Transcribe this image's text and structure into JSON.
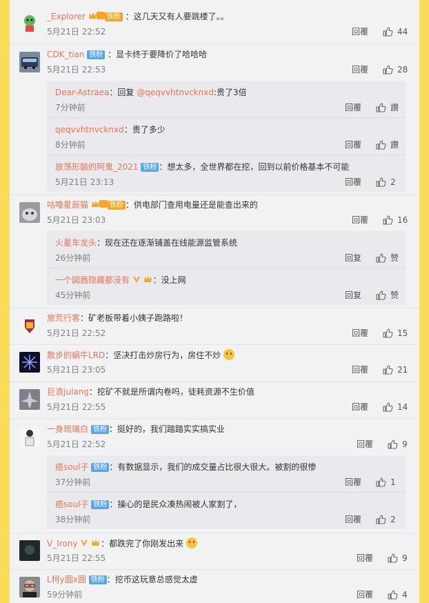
{
  "colors": {
    "accent": "#eb7350",
    "page_bg": "#f8dd5a",
    "badge": "#59a7e8"
  },
  "comments": [
    {
      "user": "_Explorer",
      "badge": "铁粉",
      "crown": true,
      "vip": false,
      "text": "：这几天又有人要跳楼了。。",
      "time": "5月21日 22:52",
      "reply_label": "回覆",
      "likes": "44",
      "avatar_icon": "green-cartoon-avatar"
    },
    {
      "user": "CDK_tian",
      "badge": "铁粉",
      "crown": false,
      "vip": false,
      "text": "：显卡终于要降价了哈哈哈",
      "time": "5月21日 22:53",
      "reply_label": "回覆",
      "likes": "28",
      "avatar_icon": "bus-avatar",
      "replies": [
        {
          "user": "Dear-Astraea",
          "prefix": "：回复 ",
          "at": "@qeqvvhtnvcknxd",
          "text": ":贵了3倍",
          "time": "7分钟前",
          "reply_label": "回覆",
          "likes": "讚"
        },
        {
          "user": "qeqvvhtnvcknxd",
          "text": "：贵了多少",
          "time": "8分钟前",
          "reply_label": "回覆",
          "likes": "讚"
        },
        {
          "user": "放荡形骸的阿鬼_2021",
          "badge": "铁粉",
          "text": "：想太多，全世界都在挖，回到以前价格基本不可能",
          "time": "5月21日 23:13",
          "reply_label": "回覆",
          "likes": "2"
        }
      ]
    },
    {
      "user": "咕噜星辰猫",
      "badge": "铁粉",
      "crown": true,
      "vip": false,
      "text": "：供电部门查用电量还是能查出来的",
      "time": "5月21日 23:03",
      "reply_label": "回覆",
      "likes": "16",
      "avatar_icon": "cat-avatar",
      "replies": [
        {
          "user": "火星车龙头",
          "text": "：现在还在逐渐铺盖在线能源监管系统",
          "time": "26分钟前",
          "reply_label": "回复",
          "likes": "赞"
        },
        {
          "user": "一个図茜隐藏都没有",
          "vip": true,
          "crown": true,
          "text": "：没上网",
          "time": "45分钟前",
          "reply_label": "回复",
          "likes": "赞"
        }
      ]
    },
    {
      "user": "旅荒行客",
      "text": "：矿老板带着小姨子跑路啦！",
      "time": "5月21日 22:52",
      "reply_label": "回覆",
      "likes": "15",
      "avatar_icon": "ironman-avatar"
    },
    {
      "user": "散步的蜗牛LRD",
      "text": "：坚决打击炒房行为，房住不炒",
      "emoji": "smile-emoji",
      "time": "5月21日 23:05",
      "reply_label": "回覆",
      "likes": "21",
      "avatar_icon": "snowflake-avatar"
    },
    {
      "user": "巨浪julang",
      "text": "：挖矿不就是所谓内卷吗，徒耗资源不生价值",
      "time": "5月21日 22:55",
      "reply_label": "回覆",
      "likes": "14",
      "avatar_icon": "jet-avatar"
    },
    {
      "user": "一身琉璃白",
      "badge": "铁粉",
      "text": "：挺好的，我们踏踏实实搞实业",
      "time": "5月21日 22:52",
      "reply_label": "回覆",
      "likes": "9",
      "avatar_icon": "person-avatar",
      "replies": [
        {
          "user": "癌soul子",
          "badge": "铁粉",
          "text": "：有数据显示，我们的成交量占比很大很大。被割的很惨",
          "time": "37分钟前",
          "reply_label": "回覆",
          "likes": "1"
        },
        {
          "user": "癌soul子",
          "badge": "铁粉",
          "text": "：操心的是民众凑热闹被人家割了，",
          "time": "38分钟前",
          "reply_label": "回覆",
          "likes": "2"
        }
      ]
    },
    {
      "user": "V_Irony",
      "vip": true,
      "crown": true,
      "text": "：都跌完了你刚发出来",
      "emoji": "laugh-emoji",
      "time": "5月21日 22:55",
      "reply_label": "回覆",
      "likes": "9",
      "avatar_icon": "dark-avatar"
    },
    {
      "user": "L柯y圆x圆",
      "badge": "铁粉",
      "text": "：挖币这玩意总感觉太虚",
      "time": "59分钟前",
      "reply_label": "回覆",
      "likes": "4",
      "avatar_icon": "glasses-man-avatar"
    }
  ]
}
